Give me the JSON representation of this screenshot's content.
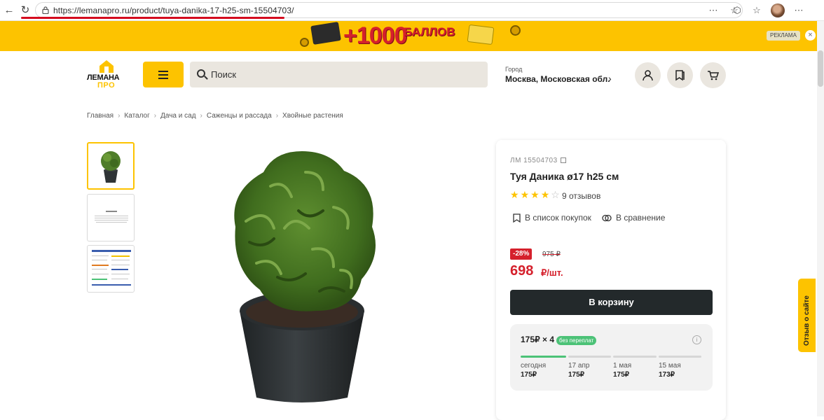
{
  "browser": {
    "url": "https://lemanapro.ru/product/tuya-danika-17-h25-sm-15504703/"
  },
  "banner": {
    "promo_text": "+1000",
    "promo_sub": "БАЛЛОВ",
    "ad_label": "РЕКЛАМА"
  },
  "header": {
    "logo_name": "ЛЕМАНА",
    "logo_sub": "ПРО",
    "search_placeholder": "Поиск",
    "city_label": "Город",
    "city_value": "Москва, Московская обл."
  },
  "breadcrumbs": [
    "Главная",
    "Каталог",
    "Дача и сад",
    "Саженцы и рассада",
    "Хвойные растения"
  ],
  "product": {
    "article": "ЛМ 15504703",
    "title": "Туя Даника ø17 h25 см",
    "rating": 4,
    "reviews": "9 отзывов",
    "shopping_list": "В список покупок",
    "compare": "В сравнение",
    "discount": "-28%",
    "old_price": "975 ₽",
    "price": "698",
    "price_unit": "₽/шт.",
    "cart_button": "В корзину"
  },
  "installment": {
    "summary": "175₽ × 4",
    "badge": "без переплат",
    "payments": [
      {
        "date": "сегодня",
        "sum": "175₽"
      },
      {
        "date": "17 апр",
        "sum": "175₽"
      },
      {
        "date": "1 мая",
        "sum": "175₽"
      },
      {
        "date": "15 мая",
        "sum": "173₽"
      }
    ]
  },
  "feedback_tab": "Отзыв о сайте",
  "colors": {
    "brand_yellow": "#fdc300",
    "price_red": "#d5202c",
    "dark_button": "#23292b",
    "installment_green": "#4cc277"
  }
}
